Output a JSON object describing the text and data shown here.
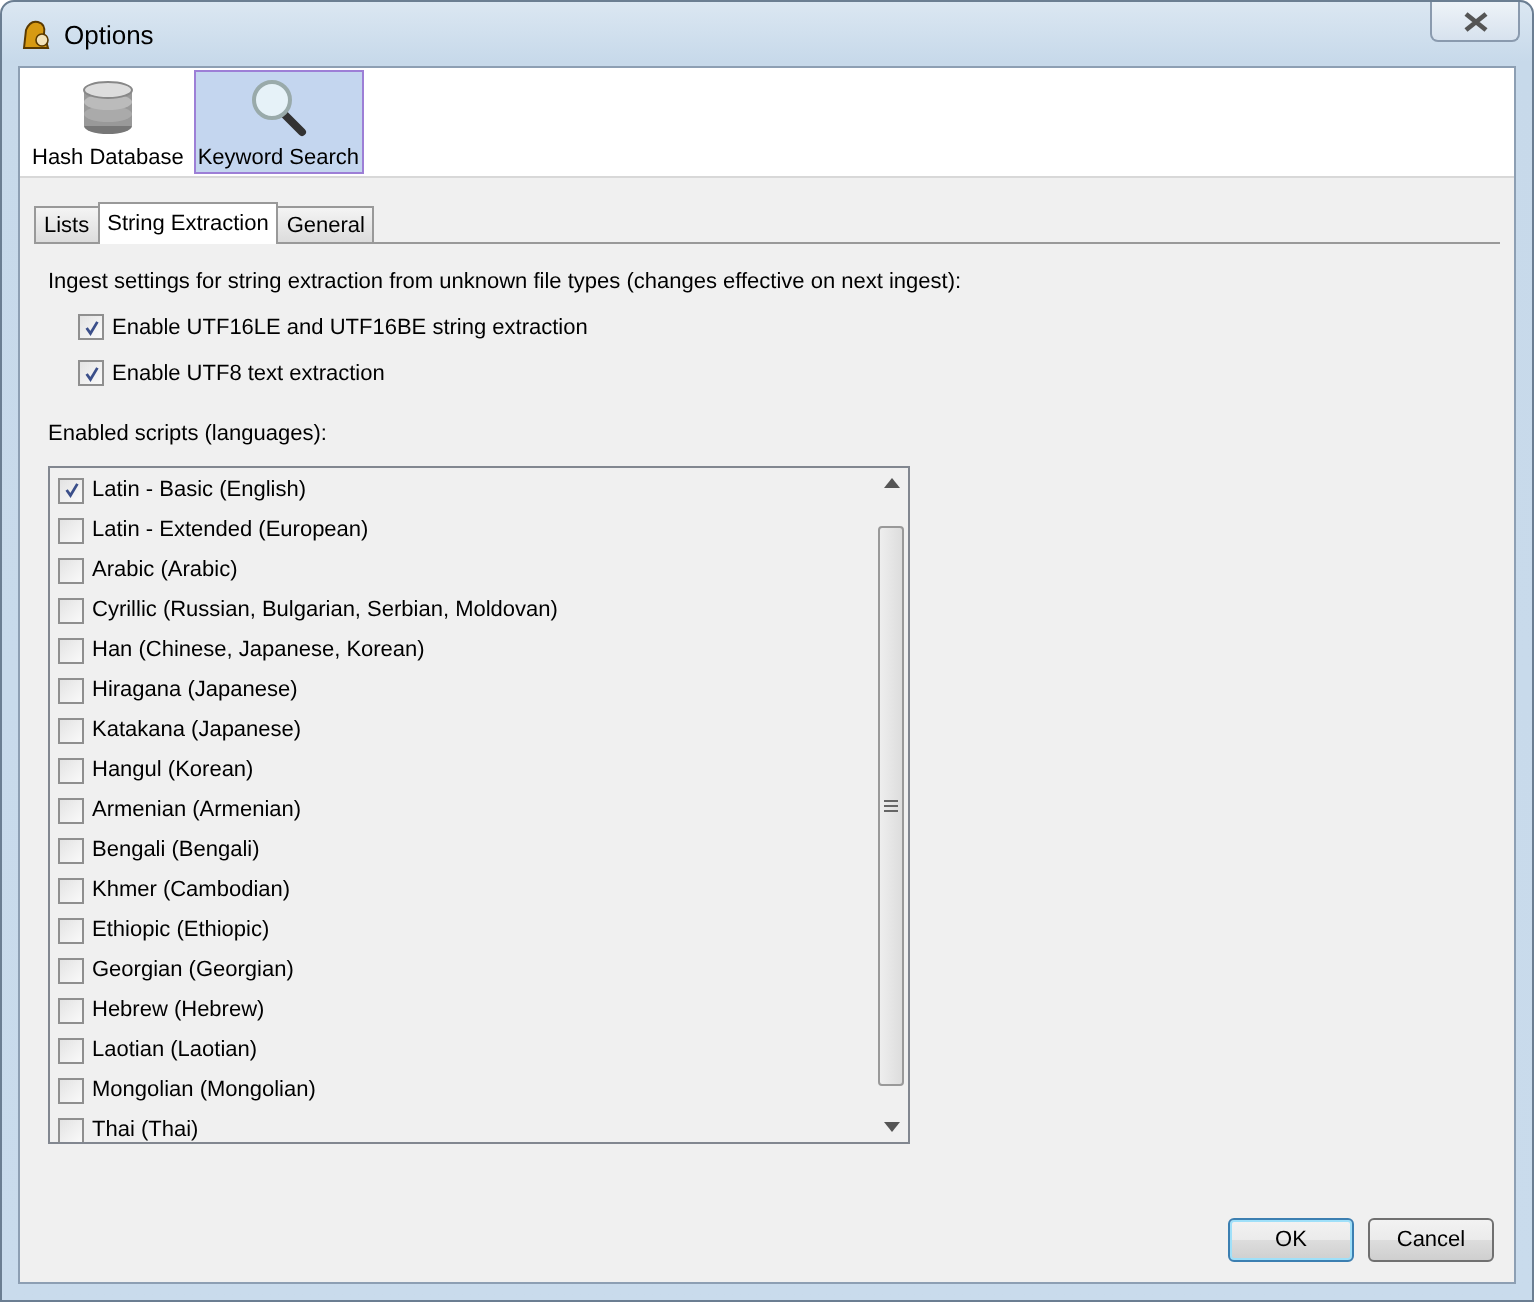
{
  "window": {
    "title": "Options"
  },
  "toolbar": [
    {
      "label": "Hash Database",
      "kind": "database",
      "selected": false
    },
    {
      "label": "Keyword Search",
      "kind": "magnifier",
      "selected": true
    }
  ],
  "tabs": [
    {
      "label": "Lists",
      "selected": false
    },
    {
      "label": "String Extraction",
      "selected": true
    },
    {
      "label": "General",
      "selected": false
    }
  ],
  "ingest_heading": "Ingest settings for string extraction from unknown file types (changes effective on next ingest):",
  "options": [
    {
      "label": "Enable UTF16LE and UTF16BE string extraction",
      "checked": true
    },
    {
      "label": "Enable UTF8 text extraction",
      "checked": true
    }
  ],
  "scripts_heading": "Enabled scripts (languages):",
  "scripts": [
    {
      "label": "Latin - Basic (English)",
      "checked": true
    },
    {
      "label": "Latin - Extended (European)",
      "checked": false
    },
    {
      "label": "Arabic (Arabic)",
      "checked": false
    },
    {
      "label": "Cyrillic (Russian, Bulgarian, Serbian, Moldovan)",
      "checked": false
    },
    {
      "label": "Han (Chinese, Japanese, Korean)",
      "checked": false
    },
    {
      "label": "Hiragana (Japanese)",
      "checked": false
    },
    {
      "label": "Katakana (Japanese)",
      "checked": false
    },
    {
      "label": "Hangul (Korean)",
      "checked": false
    },
    {
      "label": "Armenian (Armenian)",
      "checked": false
    },
    {
      "label": "Bengali (Bengali)",
      "checked": false
    },
    {
      "label": "Khmer (Cambodian)",
      "checked": false
    },
    {
      "label": "Ethiopic (Ethiopic)",
      "checked": false
    },
    {
      "label": "Georgian (Georgian)",
      "checked": false
    },
    {
      "label": "Hebrew (Hebrew)",
      "checked": false
    },
    {
      "label": "Laotian (Laotian)",
      "checked": false
    },
    {
      "label": "Mongolian (Mongolian)",
      "checked": false
    },
    {
      "label": "Thai (Thai)",
      "checked": false
    }
  ],
  "buttons": [
    {
      "label": "OK",
      "default": true
    },
    {
      "label": "Cancel",
      "default": false
    }
  ]
}
